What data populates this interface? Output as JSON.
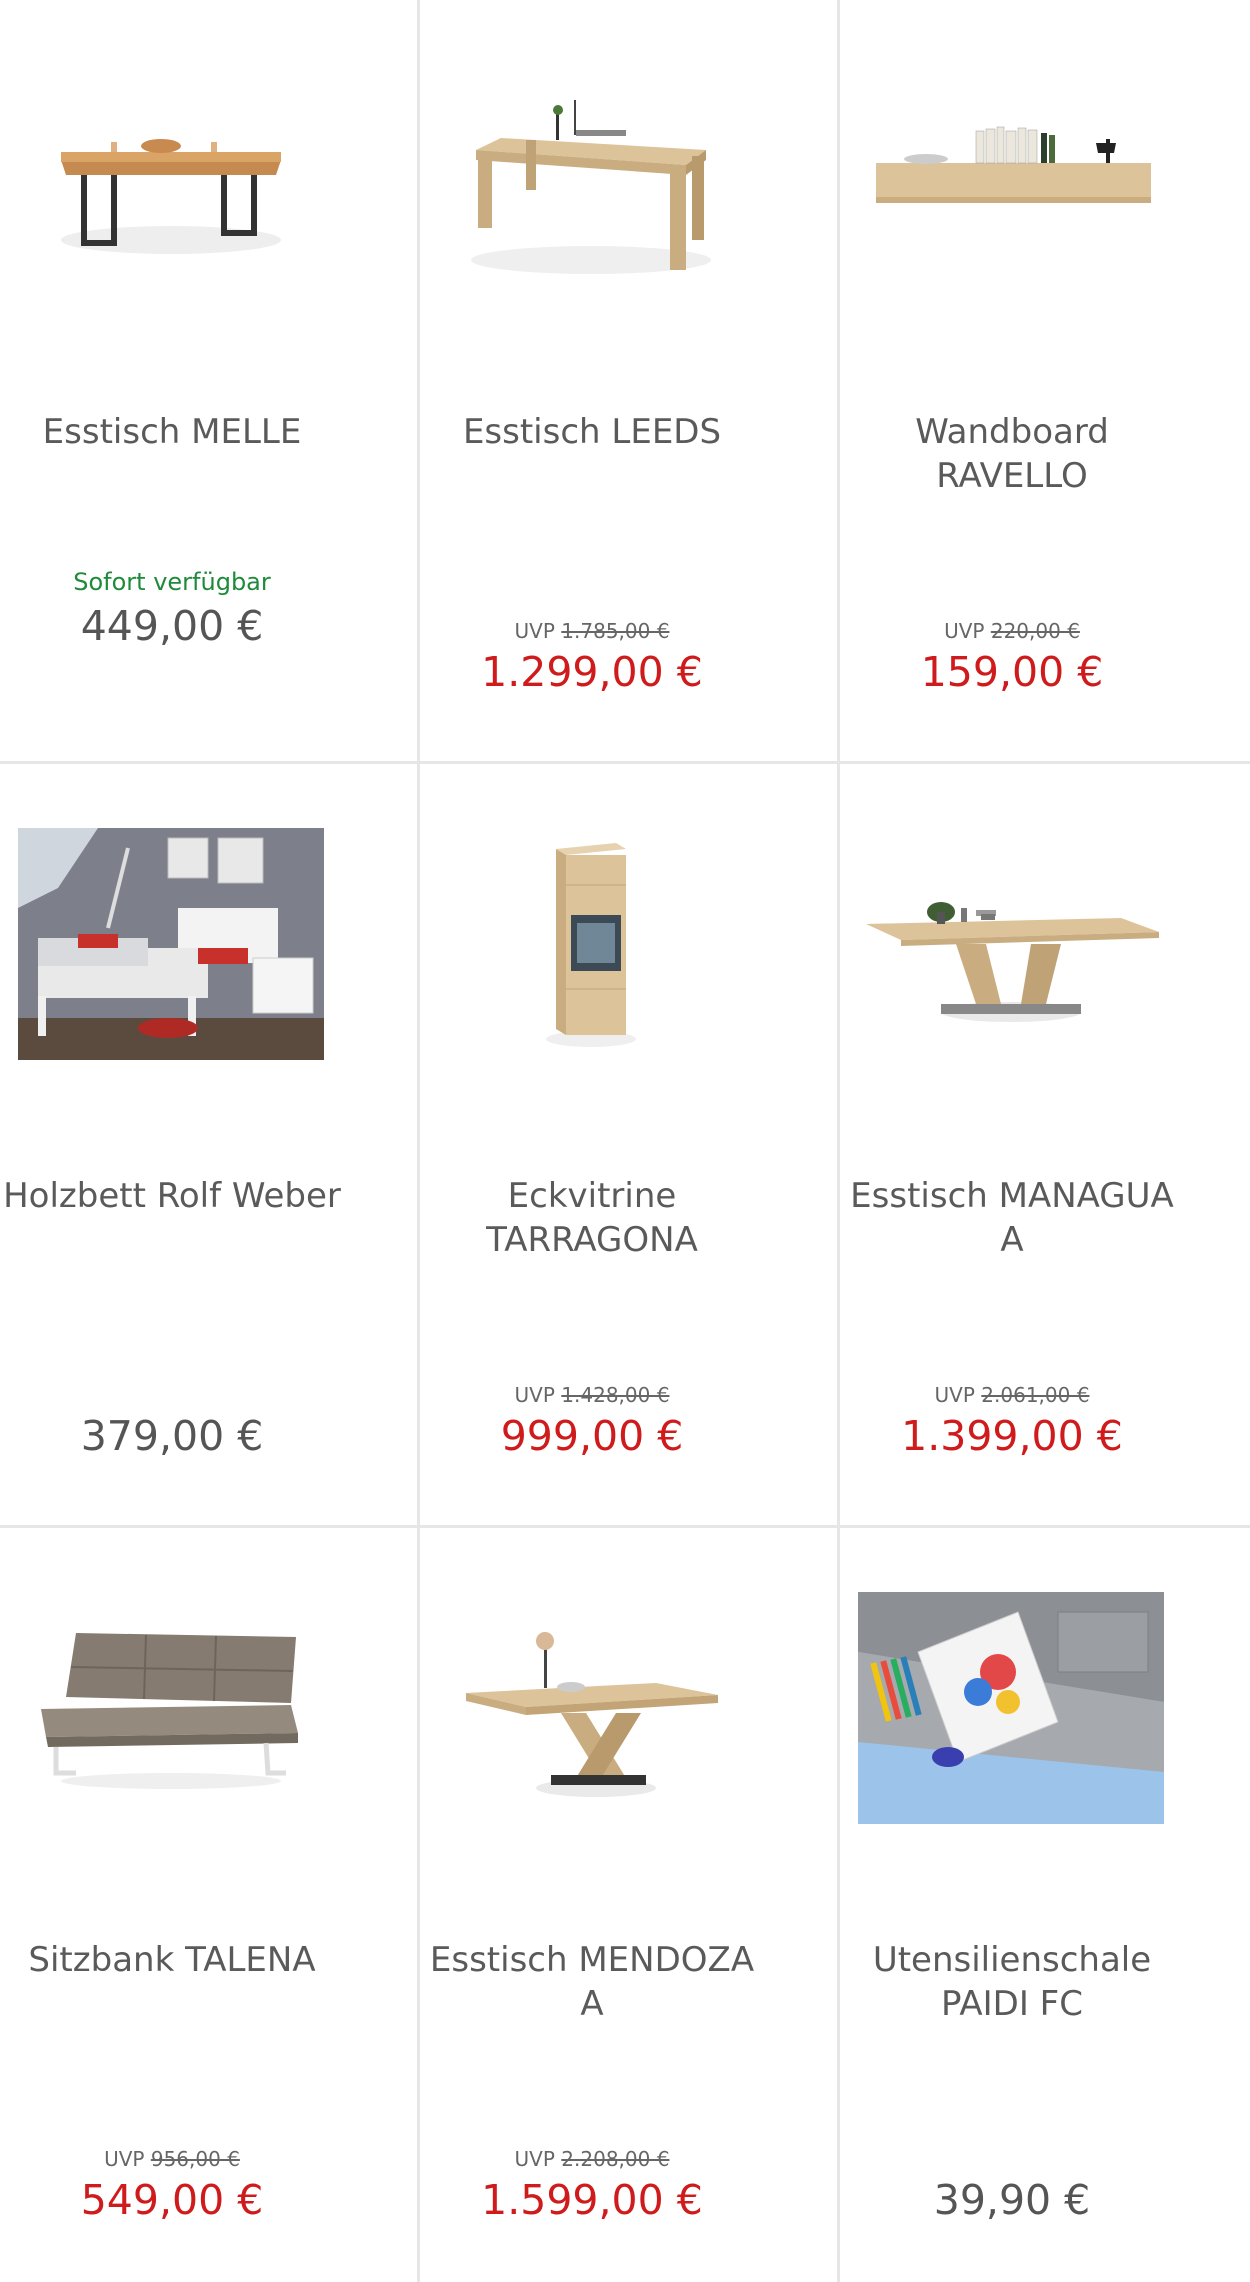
{
  "products": [
    {
      "name": "Esstisch MELLE",
      "availability": "Sofort verfügbar",
      "uvp_label": "",
      "uvp_price": "",
      "price": "449,00 €",
      "sale": false,
      "icon": "table-icon"
    },
    {
      "name": "Esstisch LEEDS",
      "availability": "",
      "uvp_label": "UVP",
      "uvp_price": "1.785,00 €",
      "price": "1.299,00 €",
      "sale": true,
      "icon": "table-icon"
    },
    {
      "name": "Wandboard RAVELLO",
      "availability": "",
      "uvp_label": "UVP",
      "uvp_price": "220,00 €",
      "price": "159,00 €",
      "sale": true,
      "icon": "shelf-icon"
    },
    {
      "name": "Holzbett Rolf Weber",
      "availability": "",
      "uvp_label": "",
      "uvp_price": "",
      "price": "379,00 €",
      "sale": false,
      "icon": "bed-icon"
    },
    {
      "name": "Eckvitrine TARRAGONA",
      "availability": "",
      "uvp_label": "UVP",
      "uvp_price": "1.428,00 €",
      "price": "999,00 €",
      "sale": true,
      "icon": "cabinet-icon"
    },
    {
      "name": "Esstisch MANAGUA A",
      "availability": "",
      "uvp_label": "UVP",
      "uvp_price": "2.061,00 €",
      "price": "1.399,00 €",
      "sale": true,
      "icon": "table-icon"
    },
    {
      "name": "Sitzbank TALENA",
      "availability": "",
      "uvp_label": "UVP",
      "uvp_price": "956,00 €",
      "price": "549,00 €",
      "sale": true,
      "icon": "bench-icon"
    },
    {
      "name": "Esstisch MENDOZA A",
      "availability": "",
      "uvp_label": "UVP",
      "uvp_price": "2.208,00 €",
      "price": "1.599,00 €",
      "sale": true,
      "icon": "table-icon"
    },
    {
      "name": "Utensilienschale PAIDI FC",
      "availability": "",
      "uvp_label": "",
      "uvp_price": "",
      "price": "39,90 €",
      "sale": false,
      "icon": "tray-icon"
    }
  ],
  "colors": {
    "sale_price": "#cf1b1b",
    "availability": "#1f8a3a",
    "regular_price": "#555555",
    "divider": "#e6e6e6"
  }
}
